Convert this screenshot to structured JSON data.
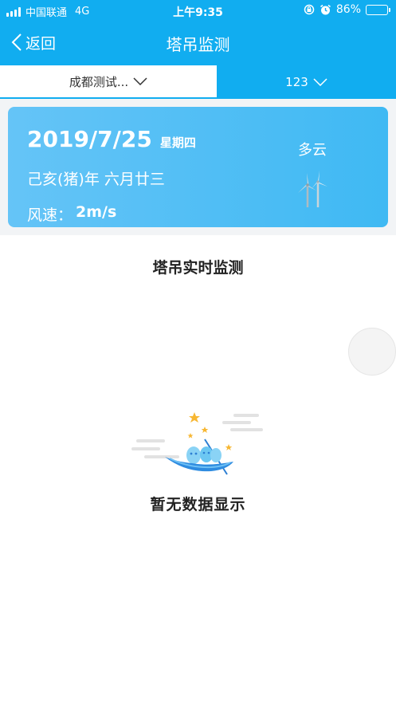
{
  "status_bar": {
    "carrier": "中国联通",
    "network": "4G",
    "time": "上午9:35",
    "battery": "86%",
    "battery_level": 0.86
  },
  "nav": {
    "back_label": "返回",
    "title": "塔吊监测"
  },
  "filters": {
    "project": "成都测试...",
    "device": "123"
  },
  "weather": {
    "date": "2019/7/25",
    "weekday": "星期四",
    "lunar": "己亥(猪)年 六月廿三",
    "wind_label": "风速：",
    "wind_value": "2m/s",
    "condition": "多云",
    "condition_icon": "wind-turbine-icon"
  },
  "section": {
    "title": "塔吊实时监测"
  },
  "empty_state": {
    "message": "暂无数据显示",
    "illustration": "boat-with-stars-icon"
  },
  "colors": {
    "primary": "#11adf0",
    "card_start": "#65c4f7",
    "card_end": "#3fb9f3"
  }
}
